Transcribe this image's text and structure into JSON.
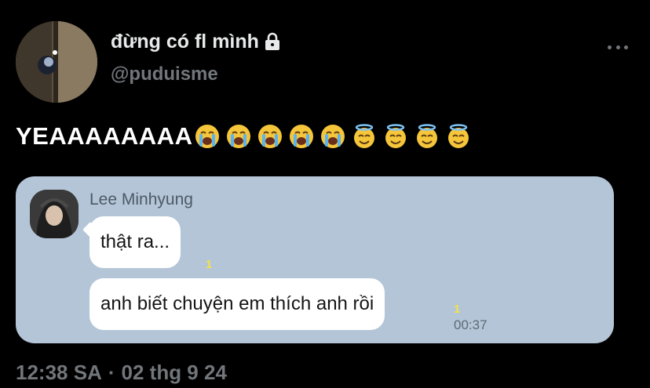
{
  "author": {
    "display_name": "đừng có fl mình",
    "handle": "@puduisme",
    "avatar_icon": "profile-photo",
    "protected_icon": "lock-icon"
  },
  "more_icon": "more-horizontal-icon",
  "tweet": {
    "text": "YEAAAAAAAA",
    "emojis": [
      "loudly-crying-face",
      "loudly-crying-face",
      "loudly-crying-face",
      "loudly-crying-face",
      "loudly-crying-face",
      "smiling-face-with-halo",
      "smiling-face-with-halo",
      "smiling-face-with-halo",
      "smiling-face-with-halo"
    ]
  },
  "media": {
    "sender_name": "Lee Minhyung",
    "messages": [
      {
        "text": "thật ra...",
        "read_count": "1"
      },
      {
        "text": "anh biết chuyện em thích anh rồi",
        "read_count": "1",
        "time": "00:37"
      }
    ],
    "background_color": "#b3c5d7"
  },
  "footer": {
    "time": "12:38 SA",
    "separator": "·",
    "date": "02 thg 9 24"
  }
}
